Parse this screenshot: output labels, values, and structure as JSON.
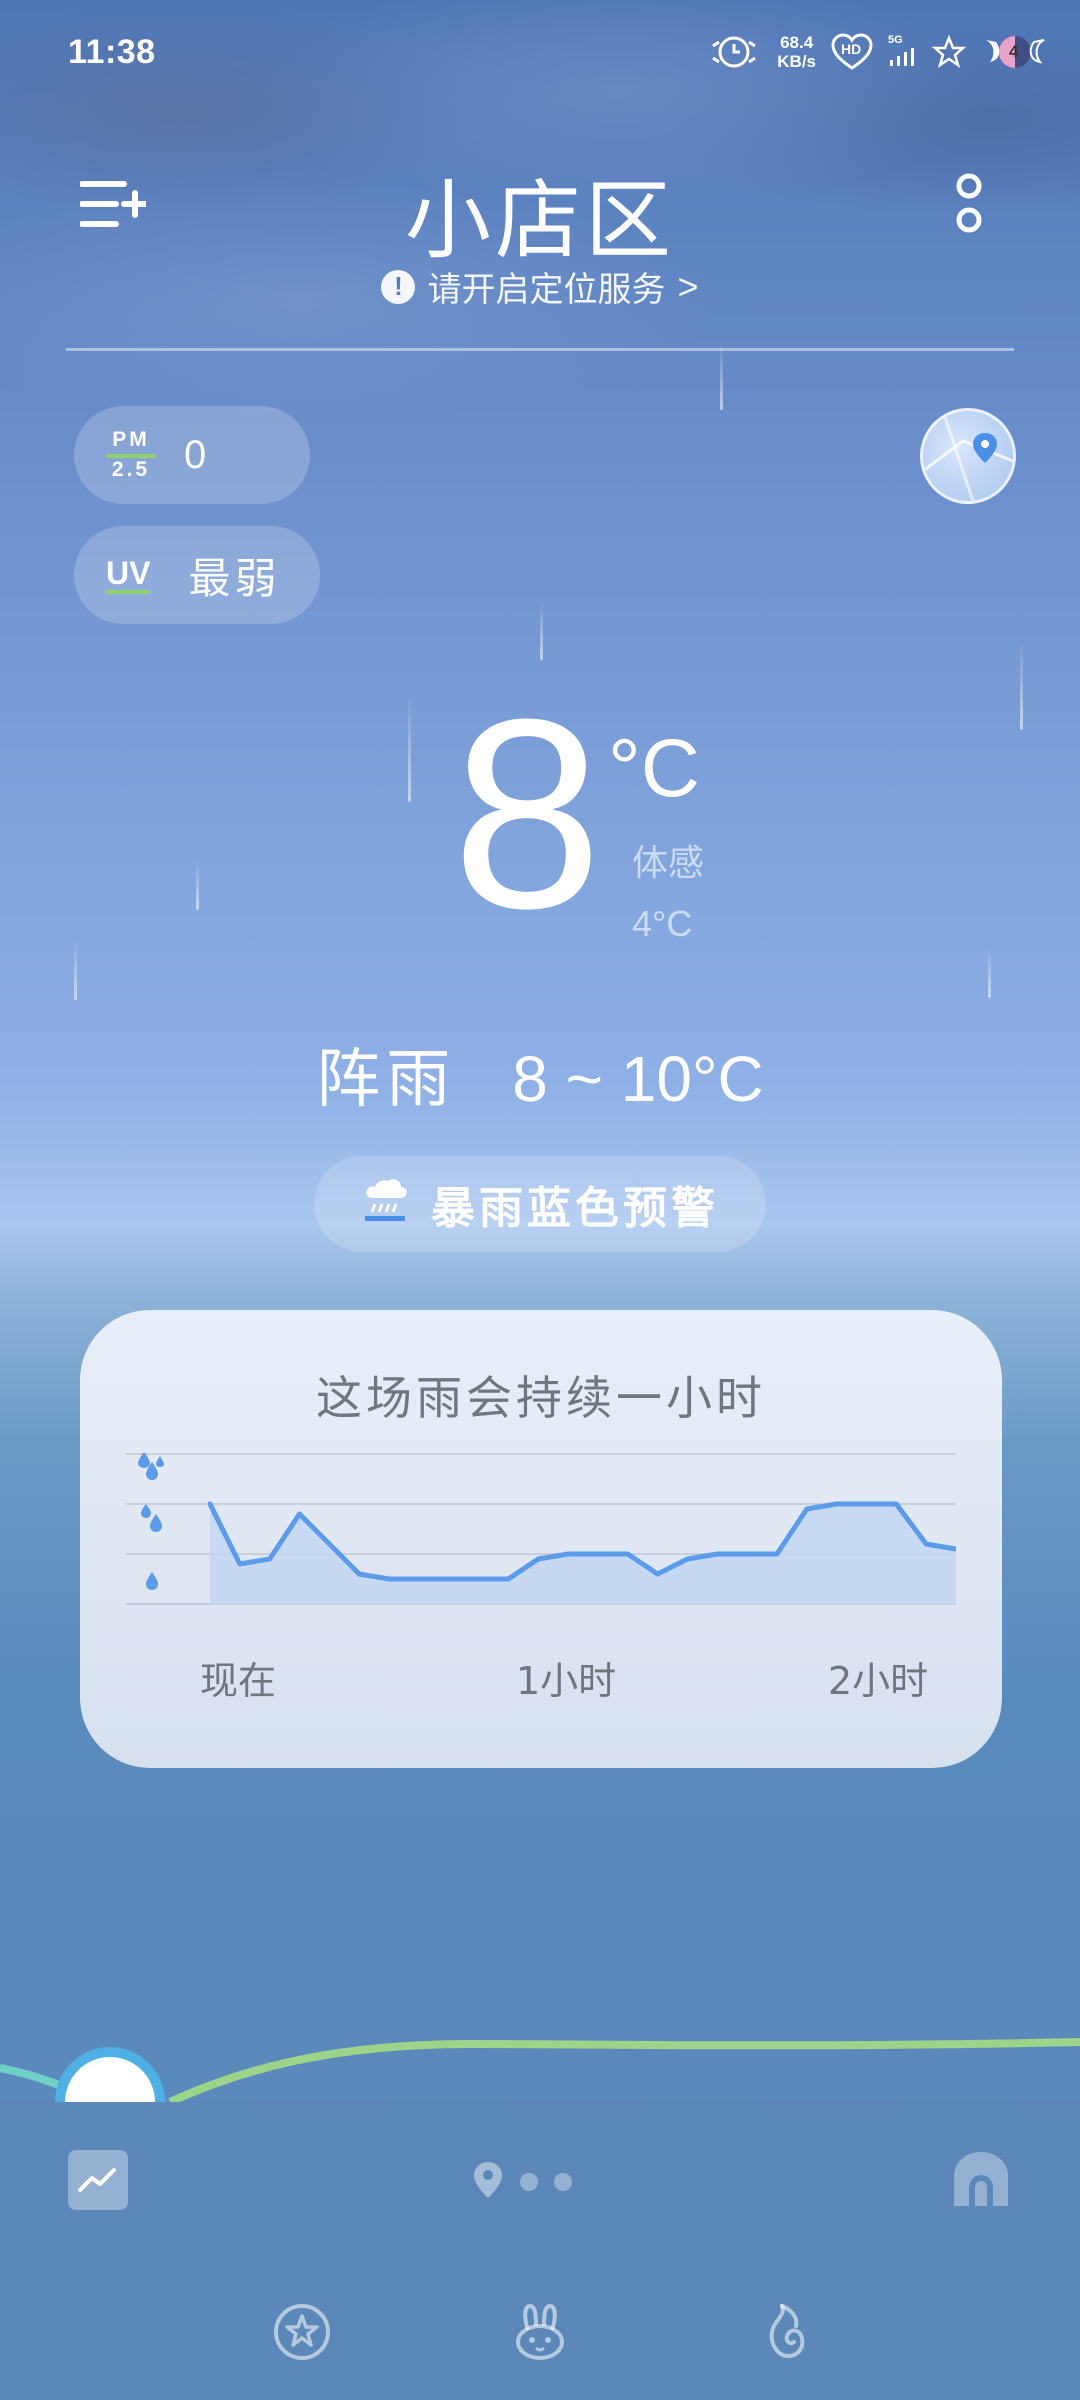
{
  "status_bar": {
    "time": "11:38",
    "net_speed_value": "68.4",
    "net_speed_unit": "KB/s",
    "hd_label": "HD",
    "signal_label": "5G",
    "battery_label": "4"
  },
  "header": {
    "city": "小店区",
    "location_prompt": "请开启定位服务",
    "location_prompt_icon": "!",
    "location_prompt_chevron": ">"
  },
  "air": {
    "pm_label_top": "PM",
    "pm_label_bottom": "2.5",
    "pm_value": "0",
    "uv_label": "UV",
    "uv_value": "最弱"
  },
  "current": {
    "temperature": "8",
    "unit": "°C",
    "feels_label": "体感",
    "feels_value": "4°C",
    "condition": "阵雨",
    "range": "8 ~ 10°C"
  },
  "alert": {
    "text": "暴雨蓝色预警"
  },
  "rain_card": {
    "title": "这场雨会持续一小时",
    "x_labels": [
      "现在",
      "1小时",
      "2小时"
    ]
  },
  "chart_data": {
    "type": "area",
    "title": "这场雨会持续一小时",
    "x_ticks": [
      "现在",
      "1小时",
      "2小时"
    ],
    "y_levels": [
      "light",
      "moderate",
      "heavy"
    ],
    "ylim": [
      0,
      3
    ],
    "grid": true,
    "series": [
      {
        "values": [
          2.0,
          0.8,
          0.9,
          1.8,
          1.2,
          0.6,
          0.5,
          0.5,
          0.5,
          0.5,
          0.5,
          0.9,
          1.0,
          1.0,
          1.0,
          0.6,
          0.9,
          1.0,
          1.0,
          1.0,
          1.9,
          2.0,
          2.0,
          2.0,
          1.2,
          1.1
        ]
      }
    ]
  },
  "colors": {
    "accent_green": "#8ed36b",
    "chart_line": "#5b9bea",
    "chart_fill": "#c3d6f2"
  },
  "icons": {
    "menu": "menu-add-icon",
    "more": "more-vertical-icon",
    "map": "map-location-icon",
    "alert": "rain-storm-icon",
    "trend": "trend-chart-icon",
    "home": "home-icon",
    "nav": [
      "star-badge-icon",
      "bunny-icon",
      "fire-swirl-icon"
    ]
  }
}
